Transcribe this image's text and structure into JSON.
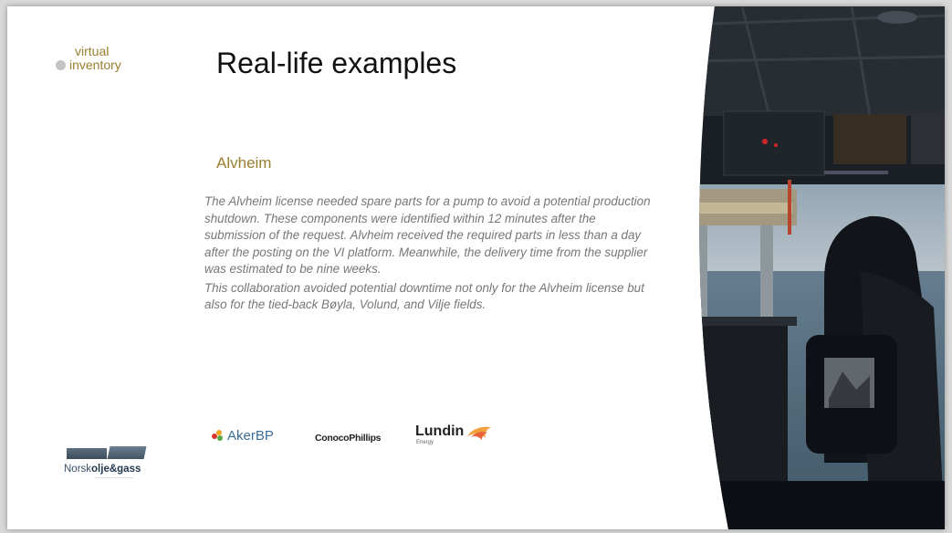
{
  "brand": {
    "line1": "virtual",
    "line2": "inventory"
  },
  "slide": {
    "title": "Real-life examples",
    "subtitle": "Alvheim",
    "paragraphs": [
      "The Alvheim license needed spare parts for a pump to avoid a potential production shutdown. These components were identified within 12 minutes after the submission of the request. Alvheim received the required parts in less than a day after the posting on the VI platform. Meanwhile, the delivery time from the supplier was estimated to be nine weeks.",
      "This collaboration avoided potential downtime not only for the Alvheim license but also for the tied-back Bøyla, Volund, and Vilje fields."
    ]
  },
  "logos": {
    "norsk": {
      "prefix": "Norsk",
      "bold": "olje&gass"
    },
    "akerbp": "AkerBP",
    "conoco": "ConocoPhillips",
    "lundin": {
      "word": "Lundin",
      "energy": "Energy"
    }
  },
  "colors": {
    "accent": "#9a7d2e",
    "title": "#111111",
    "body": "#777777",
    "background": "#d9d9d9"
  }
}
